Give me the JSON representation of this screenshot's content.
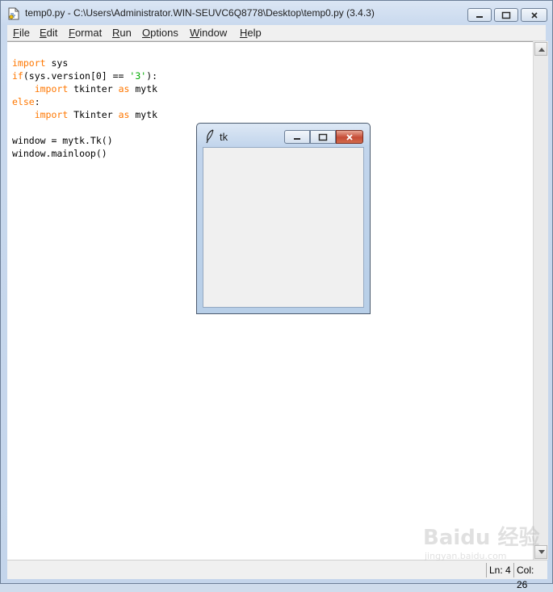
{
  "window": {
    "title": "temp0.py - C:\\Users\\Administrator.WIN-SEUVC6Q8778\\Desktop\\temp0.py (3.4.3)"
  },
  "menu": [
    {
      "label": "File"
    },
    {
      "label": "Edit"
    },
    {
      "label": "Format"
    },
    {
      "label": "Run"
    },
    {
      "label": "Options"
    },
    {
      "label": "Window"
    },
    {
      "label": "Help"
    }
  ],
  "code": {
    "line1": {
      "t1": "import",
      "t2": " sys"
    },
    "line2": {
      "t1": "if",
      "t2": "(sys.version[0] == ",
      "t3": "'3'",
      "t4": "):"
    },
    "line3": {
      "t1": "    ",
      "t2": "import",
      "t3": " tkinter ",
      "t4": "as",
      "t5": " mytk"
    },
    "line4": {
      "t1": "else",
      "t2": ":"
    },
    "line5": {
      "t1": "    ",
      "t2": "import",
      "t3": " Tkinter ",
      "t4": "as",
      "t5": " mytk"
    },
    "line7": {
      "t1": "window = mytk.Tk()"
    },
    "line8": {
      "t1": "window.mainloop()"
    }
  },
  "status": {
    "line": "Ln: 4",
    "column": "Col: 26"
  },
  "tk_window": {
    "title": "tk"
  },
  "watermark": {
    "text": "Baidu 经验",
    "subtext": "jingyan.baidu.com"
  },
  "colors": {
    "keyword": "#ff7700",
    "string": "#00aa00",
    "close_button": "#c54c36"
  }
}
